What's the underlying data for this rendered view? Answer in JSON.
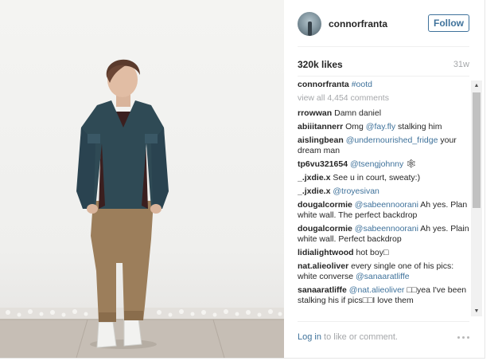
{
  "post": {
    "username": "connorfranta",
    "follow_label": "Follow",
    "likes": "320k likes",
    "age": "31w",
    "caption_user": "connorfranta",
    "caption_text": "#ootd",
    "view_all": "view all 4,454 comments",
    "login_prompt_link": "Log in",
    "login_prompt_text": " to like or comment."
  },
  "comments": [
    {
      "user": "rrowwan",
      "text": "Damn daniel"
    },
    {
      "user": "abiiitannerr",
      "text": "Omg ",
      "tag": "@fay.fly",
      "after": " stalking him"
    },
    {
      "user": "aislingbean",
      "tag": "@undernourished_fridge",
      "after": " your dream man"
    },
    {
      "user": "tp6vu321654",
      "tag": "@tsengjohnny",
      "after": " 🕸"
    },
    {
      "user": "_.jxdie.x",
      "text": "See u in court, sweaty:)"
    },
    {
      "user": "_.jxdie.x",
      "tag": "@troyesivan"
    },
    {
      "user": "dougalcormie",
      "tag": "@sabeennoorani",
      "after": " Ah yes. Plan white wall. The perfect backdrop"
    },
    {
      "user": "dougalcormie",
      "tag": "@sabeennoorani",
      "after": " Ah yes. Plain white wall. Perfect backdrop"
    },
    {
      "user": "lidialightwood",
      "text": "hot boy□"
    },
    {
      "user": "nat.alieoliver",
      "text": "every single one of his pics: white converse ",
      "tag": "@sanaaratliffe"
    },
    {
      "user": "sanaaratliffe",
      "tag": "@nat.alieoliver",
      "after": " □□yea I've been stalking his if pics□□I love them"
    }
  ],
  "icons": {
    "scroll_up": "▲",
    "scroll_down": "▼"
  },
  "colors": {
    "link": "#3f729b",
    "muted": "#a5a7aa"
  }
}
